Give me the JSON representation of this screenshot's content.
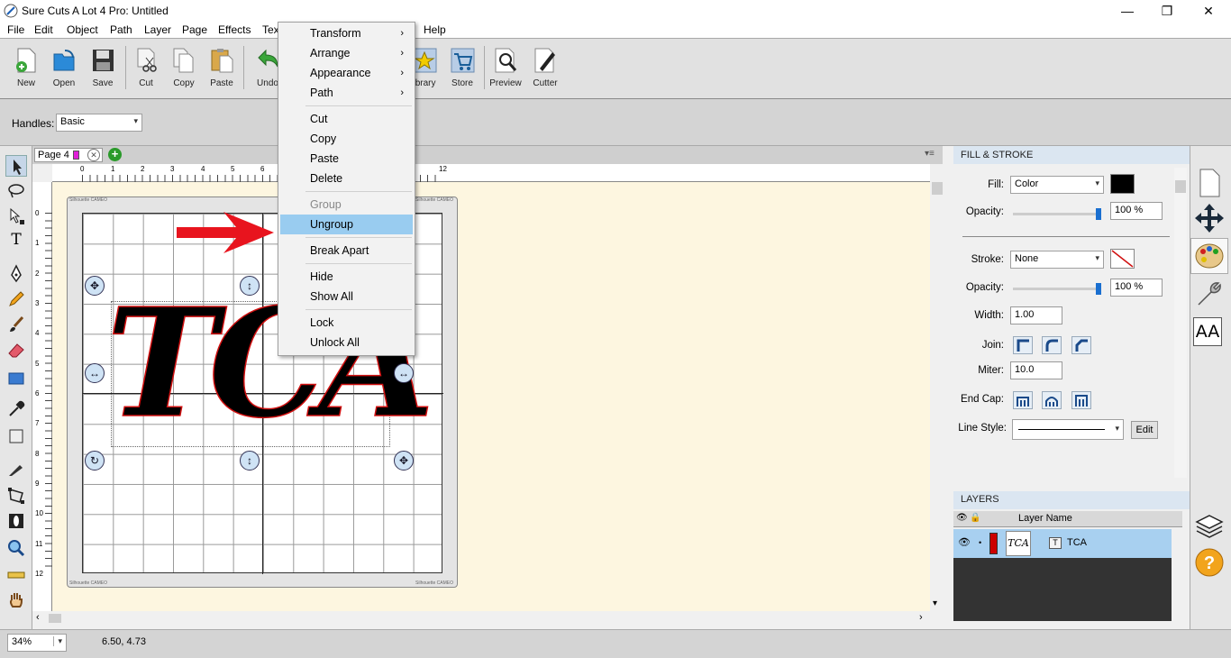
{
  "window": {
    "title": "Sure Cuts A Lot 4 Pro: Untitled",
    "minimize": "—",
    "maximize": "❐",
    "close": "✕"
  },
  "menubar": [
    "File",
    "Edit",
    "Object",
    "Path",
    "Layer",
    "Page",
    "Effects",
    "Tex",
    "Help"
  ],
  "toolbar": {
    "new": "New",
    "open": "Open",
    "save": "Save",
    "cut": "Cut",
    "copy": "Copy",
    "paste": "Paste",
    "undo": "Undo",
    "library": "ibrary",
    "store": "Store",
    "preview": "Preview",
    "cutter": "Cutter"
  },
  "handles": {
    "label": "Handles:",
    "value": "Basic"
  },
  "page_tab": {
    "label": "Page 4"
  },
  "ruler": {
    "h_ticks": [
      "0",
      "1",
      "2",
      "3",
      "4",
      "5",
      "6",
      "12"
    ],
    "v_ticks": [
      "0",
      "1",
      "2",
      "3",
      "4",
      "5",
      "6",
      "7",
      "8",
      "9",
      "10",
      "11",
      "12"
    ]
  },
  "mat": {
    "watermark": "Silhouette CAMEO"
  },
  "design_text": "TCA",
  "context_menu": {
    "transform": "Transform",
    "arrange": "Arrange",
    "appearance": "Appearance",
    "path": "Path",
    "cut": "Cut",
    "copy": "Copy",
    "paste": "Paste",
    "delete": "Delete",
    "group": "Group",
    "ungroup": "Ungroup",
    "break_apart": "Break Apart",
    "hide": "Hide",
    "show_all": "Show All",
    "lock": "Lock",
    "unlock_all": "Unlock All"
  },
  "fill_stroke": {
    "header": "FILL & STROKE",
    "fill_label": "Fill:",
    "fill_value": "Color",
    "fill_color": "#000000",
    "fill_opacity_label": "Opacity:",
    "fill_opacity": "100 %",
    "stroke_label": "Stroke:",
    "stroke_value": "None",
    "stroke_opacity_label": "Opacity:",
    "stroke_opacity": "100 %",
    "width_label": "Width:",
    "width_value": "1.00",
    "join_label": "Join:",
    "miter_label": "Miter:",
    "miter_value": "10.0",
    "endcap_label": "End Cap:",
    "linestyle_label": "Line Style:",
    "edit_button": "Edit"
  },
  "layers": {
    "header": "LAYERS",
    "column": "Layer Name",
    "layer_name": "TCA",
    "layer_color": "#cc0000",
    "thumb": "TCA"
  },
  "status": {
    "zoom": "34%",
    "coords": "6.50, 4.73"
  },
  "colors": {
    "highlight": "#99ccf0",
    "arrow": "#e8141e",
    "panel_header": "#dbe6f1",
    "canvas": "#fdf6e0"
  }
}
